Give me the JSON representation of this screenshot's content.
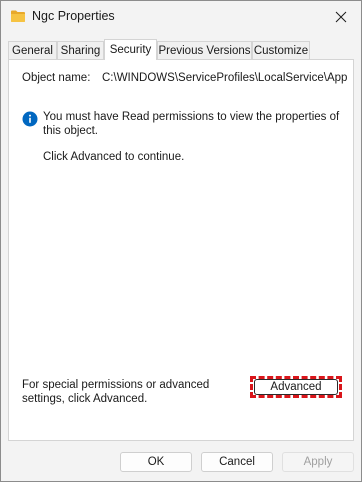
{
  "window": {
    "title": "Ngc Properties",
    "icon": "folder-icon"
  },
  "tabs": [
    {
      "label": "General",
      "active": false
    },
    {
      "label": "Sharing",
      "active": false
    },
    {
      "label": "Security",
      "active": true
    },
    {
      "label": "Previous Versions",
      "active": false
    },
    {
      "label": "Customize",
      "active": false
    }
  ],
  "security": {
    "object_name_label": "Object name:",
    "object_name_value": "C:\\WINDOWS\\ServiceProfiles\\LocalService\\AppI",
    "info_icon": "info-icon",
    "info_message": "You must have Read permissions to view the properties of this object.",
    "continue_message": "Click Advanced to continue.",
    "special_permissions_text": "For special permissions or advanced settings, click Advanced.",
    "advanced_button_label": "Advanced"
  },
  "footer": {
    "ok_label": "OK",
    "cancel_label": "Cancel",
    "apply_label": "Apply"
  },
  "colors": {
    "highlight_border": "#d9151a",
    "info_blue": "#0067c0",
    "folder_yellow": "#f6c342"
  }
}
